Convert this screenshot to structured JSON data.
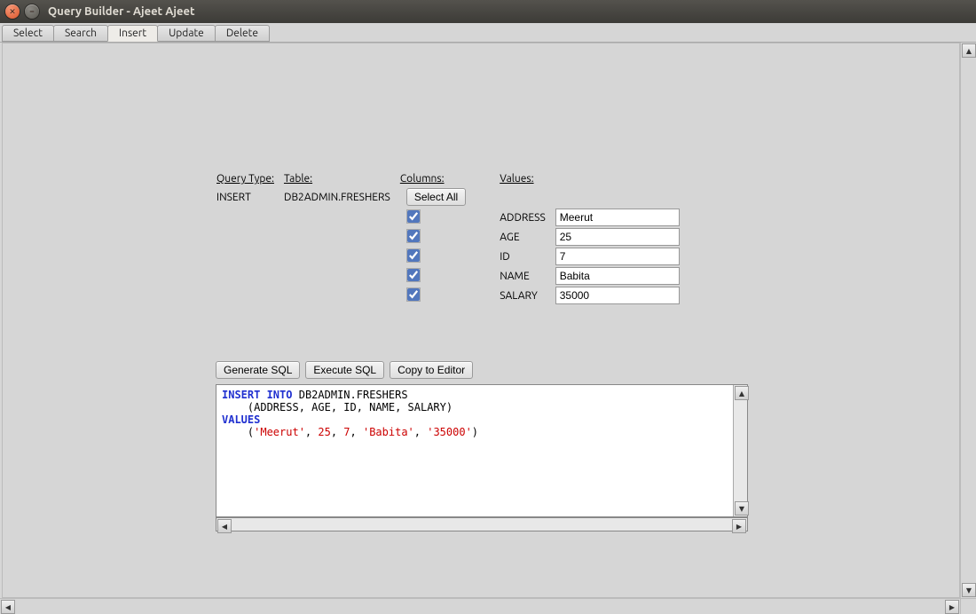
{
  "window": {
    "title": "Query Builder - Ajeet Ajeet"
  },
  "tabs": [
    "Select",
    "Search",
    "Insert",
    "Update",
    "Delete"
  ],
  "active_tab": 2,
  "headers": {
    "query_type": "Query Type:",
    "table": "Table:",
    "columns": "Columns:",
    "values": "Values:"
  },
  "query_type": "INSERT",
  "table": "DB2ADMIN.FRESHERS",
  "select_all_label": "Select All",
  "columns": [
    {
      "name": "ADDRESS",
      "checked": true,
      "value": "Meerut"
    },
    {
      "name": "AGE",
      "checked": true,
      "value": "25"
    },
    {
      "name": "ID",
      "checked": true,
      "value": "7"
    },
    {
      "name": "NAME",
      "checked": true,
      "value": "Babita"
    },
    {
      "name": "SALARY",
      "checked": true,
      "value": "35000"
    }
  ],
  "actions": {
    "generate": "Generate SQL",
    "execute": "Execute SQL",
    "copy": "Copy to Editor"
  },
  "sql": {
    "kw_insert": "INSERT INTO",
    "table_ref": "DB2ADMIN.FRESHERS",
    "cols_line": "    (ADDRESS, AGE, ID, NAME, SALARY)",
    "kw_values": "VALUES",
    "vals_prefix": "    (",
    "v1": "'Meerut'",
    "v2": "25",
    "v3": "7",
    "v4": "'Babita'",
    "v5": "'35000'",
    "vals_suffix": ")"
  }
}
